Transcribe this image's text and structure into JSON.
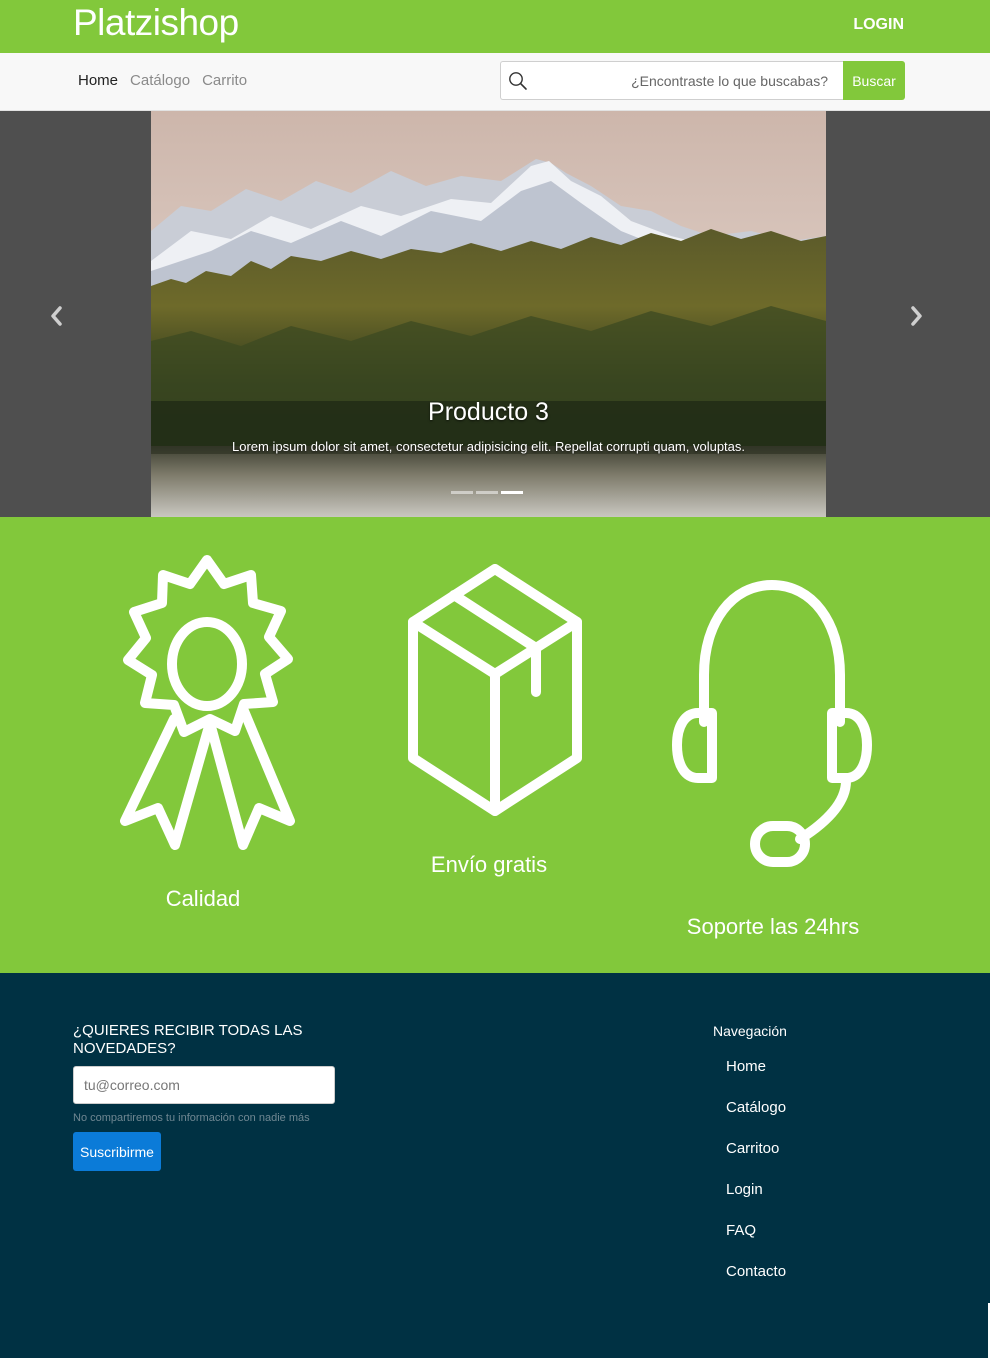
{
  "header": {
    "brand": "Platzishop",
    "login_label": "LOGIN"
  },
  "nav": {
    "links": [
      {
        "label": "Home",
        "active": true
      },
      {
        "label": "Catálogo",
        "active": false
      },
      {
        "label": "Carrito",
        "active": false
      }
    ],
    "search": {
      "icon": "search-icon",
      "placeholder": "¿Encontraste lo que buscabas?",
      "button_label": "Buscar"
    }
  },
  "carousel": {
    "caption_title": "Producto 3",
    "caption_text": "Lorem ipsum dolor sit amet, consectetur adipisicing elit. Repellat corrupti quam, voluptas.",
    "indicator_count": 3,
    "active_indicator": 3,
    "prev_icon": "chevron-left-icon",
    "next_icon": "chevron-right-icon"
  },
  "features": [
    {
      "label": "Calidad",
      "icon": "award-ribbon-icon"
    },
    {
      "label": "Envío gratis",
      "icon": "package-box-icon"
    },
    {
      "label": "Soporte las 24hrs",
      "icon": "headset-icon"
    }
  ],
  "footer": {
    "newsletter": {
      "title": "¿QUIERES RECIBIR TODAS LAS NOVEDADES?",
      "email_placeholder": "tu@correo.com",
      "help_text": "No compartiremos tu información con nadie más",
      "button_label": "Suscribirme"
    },
    "navigation": {
      "title": "Navegación",
      "items": [
        "Home",
        "Catálogo",
        "Carritoo",
        "Login",
        "FAQ",
        "Contacto"
      ]
    }
  },
  "colors": {
    "brand_green": "#82c83b",
    "footer_bg": "#003143",
    "subscribe_blue": "#0b7bd8",
    "carousel_bg": "#4f4f4f"
  }
}
